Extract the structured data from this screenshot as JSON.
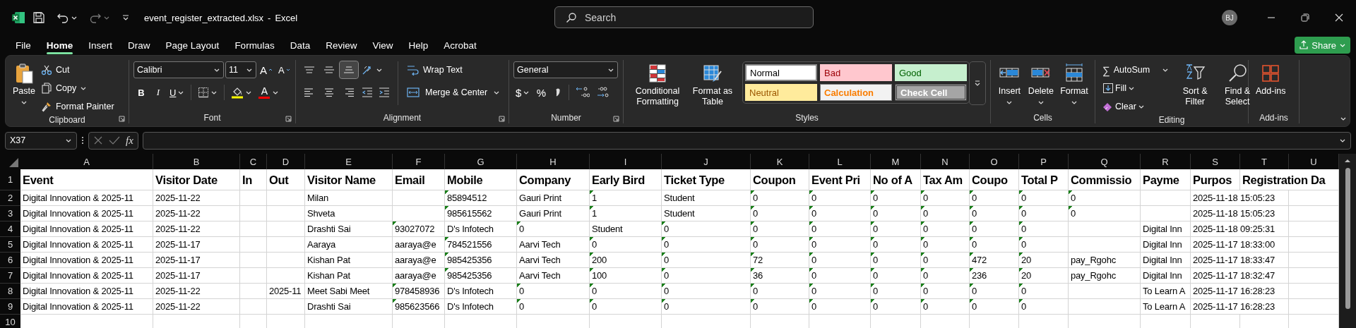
{
  "title_bar": {
    "file_name": "event_register_extracted.xlsx",
    "separator": "-",
    "app_name": "Excel",
    "search": {
      "placeholder": "Search"
    },
    "user_initials": "BJ"
  },
  "menu_tabs": [
    {
      "label": "File",
      "selected": false
    },
    {
      "label": "Home",
      "selected": true
    },
    {
      "label": "Insert",
      "selected": false
    },
    {
      "label": "Draw",
      "selected": false
    },
    {
      "label": "Page Layout",
      "selected": false
    },
    {
      "label": "Formulas",
      "selected": false
    },
    {
      "label": "Data",
      "selected": false
    },
    {
      "label": "Review",
      "selected": false
    },
    {
      "label": "View",
      "selected": false
    },
    {
      "label": "Help",
      "selected": false
    },
    {
      "label": "Acrobat",
      "selected": false
    }
  ],
  "share_button": {
    "label": "Share"
  },
  "ribbon": {
    "groups": [
      {
        "kind": "clipboard",
        "label": "Clipboard",
        "paste": "Paste",
        "cut": "Cut",
        "copy": "Copy",
        "format_painter": "Format Painter"
      },
      {
        "kind": "font",
        "label": "Font",
        "font_name": "Calibri",
        "font_size": "11",
        "grow": "A",
        "shrink": "A",
        "bold": "B",
        "italic": "I",
        "underline": "U",
        "font_color": "A"
      },
      {
        "kind": "alignment",
        "label": "Alignment",
        "vertical_align": [
          {
            "selected": false
          },
          {
            "selected": false
          },
          {
            "selected": true
          }
        ],
        "wrap_text": "Wrap Text",
        "merge_center": "Merge & Center"
      },
      {
        "kind": "number",
        "label": "Number",
        "format": "General",
        "currency": "$",
        "percent": "%"
      },
      {
        "kind": "styles",
        "label": "Styles",
        "conditional_formatting": "Conditional Formatting",
        "format_as_table": "Format as Table",
        "cell_styles": [
          {
            "label": "Normal",
            "kind": "normal"
          },
          {
            "label": "Bad",
            "kind": "bad"
          },
          {
            "label": "Good",
            "kind": "good"
          },
          {
            "label": "Neutral",
            "kind": "neutral"
          },
          {
            "label": "Calculation",
            "kind": "calculation"
          },
          {
            "label": "Check Cell",
            "kind": "check"
          }
        ]
      },
      {
        "kind": "cells",
        "label": "Cells",
        "buttons": [
          "Insert",
          "Delete",
          "Format"
        ]
      },
      {
        "kind": "editing",
        "label": "Editing",
        "autosum_symbol": "∑",
        "autosum": "AutoSum",
        "fill": "Fill",
        "clear": "Clear",
        "sort_filter": "Sort & Filter",
        "find_select": "Find & Select"
      },
      {
        "kind": "addins",
        "label": "Add-ins",
        "button": "Add-ins"
      }
    ]
  },
  "formula_bar": {
    "name_box": "X37",
    "function_label": "fx"
  },
  "sheet": {
    "columns": [
      "A",
      "B",
      "C",
      "D",
      "E",
      "F",
      "G",
      "H",
      "I",
      "J",
      "K",
      "L",
      "M",
      "N",
      "O",
      "P",
      "Q",
      "R",
      "S",
      "T",
      "U"
    ],
    "rows": [
      {
        "number": "1",
        "kind": "header",
        "cells": [
          {
            "text": "Event",
            "warning": false
          },
          {
            "text": "Visitor Date",
            "warning": false
          },
          {
            "text": "In",
            "warning": false
          },
          {
            "text": "Out",
            "warning": false
          },
          {
            "text": "Visitor Name",
            "warning": false
          },
          {
            "text": "Email",
            "warning": false
          },
          {
            "text": "Mobile",
            "warning": false
          },
          {
            "text": "Company",
            "warning": false
          },
          {
            "text": "Early Bird",
            "warning": false
          },
          {
            "text": "Ticket Type",
            "warning": false
          },
          {
            "text": "Coupon",
            "warning": false
          },
          {
            "text": "Event Pri",
            "warning": false
          },
          {
            "text": "No of A",
            "warning": false
          },
          {
            "text": "Tax Am",
            "warning": false
          },
          {
            "text": "Coupo",
            "warning": false
          },
          {
            "text": "Total P",
            "warning": false
          },
          {
            "text": "Commissio",
            "warning": false
          },
          {
            "text": "Payme",
            "warning": false
          },
          {
            "text": "Purpos",
            "warning": false
          },
          {
            "text": "Registration Da",
            "warning": false
          }
        ]
      },
      {
        "number": "2",
        "kind": "data",
        "cells": [
          {
            "text": "Digital Innovation & 2025-11",
            "warning": false
          },
          {
            "text": "2025-11-22",
            "warning": false
          },
          {
            "warning": false
          },
          {
            "warning": false
          },
          {
            "text": "Milan",
            "warning": false
          },
          {
            "warning": false
          },
          {
            "text": "85894512",
            "warning": true
          },
          {
            "text": "Gauri Print",
            "warning": false
          },
          {
            "text": "1",
            "warning": true
          },
          {
            "text": "Student",
            "warning": false
          },
          {
            "text": "0",
            "warning": true
          },
          {
            "text": "0",
            "warning": true
          },
          {
            "text": "0",
            "warning": true
          },
          {
            "text": "0",
            "warning": true
          },
          {
            "text": "0",
            "warning": true
          },
          {
            "text": "0",
            "warning": true
          },
          {
            "text": "0",
            "warning": true
          },
          {
            "warning": false
          },
          {
            "text": "2025-11-18 15:05:23",
            "warning": false
          }
        ]
      },
      {
        "number": "3",
        "kind": "data",
        "cells": [
          {
            "text": "Digital Innovation & 2025-11",
            "warning": false
          },
          {
            "text": "2025-11-22",
            "warning": false
          },
          {
            "warning": false
          },
          {
            "warning": false
          },
          {
            "text": "Shveta",
            "warning": false
          },
          {
            "warning": false
          },
          {
            "text": "985615562",
            "warning": true
          },
          {
            "text": "Gauri Print",
            "warning": false
          },
          {
            "text": "1",
            "warning": true
          },
          {
            "text": "Student",
            "warning": false
          },
          {
            "text": "0",
            "warning": true
          },
          {
            "text": "0",
            "warning": true
          },
          {
            "text": "0",
            "warning": true
          },
          {
            "text": "0",
            "warning": true
          },
          {
            "text": "0",
            "warning": true
          },
          {
            "text": "0",
            "warning": true
          },
          {
            "text": "0",
            "warning": true
          },
          {
            "warning": false
          },
          {
            "text": "2025-11-18 15:05:23",
            "warning": false
          }
        ]
      },
      {
        "number": "4",
        "kind": "data",
        "cells": [
          {
            "text": "Digital Innovation & 2025-11",
            "warning": false
          },
          {
            "text": "2025-11-22",
            "warning": false
          },
          {
            "warning": false
          },
          {
            "warning": false
          },
          {
            "text": "Drashti Sai",
            "warning": false
          },
          {
            "text": "93027072",
            "warning": true
          },
          {
            "text": "D's Infotech",
            "warning": false
          },
          {
            "text": "0",
            "warning": true
          },
          {
            "text": "Student",
            "warning": false
          },
          {
            "text": "0",
            "warning": true
          },
          {
            "text": "0",
            "warning": true
          },
          {
            "text": "0",
            "warning": true
          },
          {
            "text": "0",
            "warning": true
          },
          {
            "text": "0",
            "warning": true
          },
          {
            "text": "0",
            "warning": true
          },
          {
            "text": "0",
            "warning": true
          },
          {
            "warning": false
          },
          {
            "text": "Digital Inn",
            "warning": false
          },
          {
            "text": "2025-11-18 09:25:31",
            "warning": false
          }
        ]
      },
      {
        "number": "5",
        "kind": "data",
        "cells": [
          {
            "text": "Digital Innovation & 2025-11",
            "warning": false
          },
          {
            "text": "2025-11-17",
            "warning": false
          },
          {
            "warning": false
          },
          {
            "warning": false
          },
          {
            "text": "Aaraya",
            "warning": false
          },
          {
            "text": "aaraya@e",
            "warning": false
          },
          {
            "text": "784521556",
            "warning": true
          },
          {
            "text": "Aarvi Tech",
            "warning": false
          },
          {
            "text": "0",
            "warning": true
          },
          {
            "text": "0",
            "warning": true
          },
          {
            "text": "0",
            "warning": true
          },
          {
            "text": "0",
            "warning": true
          },
          {
            "text": "0",
            "warning": true
          },
          {
            "text": "0",
            "warning": true
          },
          {
            "text": "0",
            "warning": true
          },
          {
            "text": "0",
            "warning": true
          },
          {
            "warning": false
          },
          {
            "text": "Digital Inn",
            "warning": false
          },
          {
            "text": "2025-11-17 18:33:00",
            "warning": false
          }
        ]
      },
      {
        "number": "6",
        "kind": "data",
        "cells": [
          {
            "text": "Digital Innovation & 2025-11",
            "warning": false
          },
          {
            "text": "2025-11-17",
            "warning": false
          },
          {
            "warning": false
          },
          {
            "warning": false
          },
          {
            "text": "Kishan Pat",
            "warning": false
          },
          {
            "text": "aaraya@e",
            "warning": false
          },
          {
            "text": "985425356",
            "warning": true
          },
          {
            "text": "Aarvi Tech",
            "warning": false
          },
          {
            "text": "200",
            "warning": true
          },
          {
            "text": "0",
            "warning": true
          },
          {
            "text": "72",
            "warning": true
          },
          {
            "text": "0",
            "warning": true
          },
          {
            "text": "0",
            "warning": true
          },
          {
            "text": "0",
            "warning": true
          },
          {
            "text": "472",
            "warning": true
          },
          {
            "text": "20",
            "warning": true
          },
          {
            "text": "pay_Rgohc",
            "warning": false
          },
          {
            "text": "Digital Inn",
            "warning": false
          },
          {
            "text": "2025-11-17 18:33:47",
            "warning": false
          }
        ]
      },
      {
        "number": "7",
        "kind": "data",
        "cells": [
          {
            "text": "Digital Innovation & 2025-11",
            "warning": false
          },
          {
            "text": "2025-11-17",
            "warning": false
          },
          {
            "warning": false
          },
          {
            "warning": false
          },
          {
            "text": "Kishan Pat",
            "warning": false
          },
          {
            "text": "aaraya@e",
            "warning": false
          },
          {
            "text": "985425356",
            "warning": true
          },
          {
            "text": "Aarvi Tech",
            "warning": false
          },
          {
            "text": "100",
            "warning": true
          },
          {
            "text": "0",
            "warning": true
          },
          {
            "text": "36",
            "warning": true
          },
          {
            "text": "0",
            "warning": true
          },
          {
            "text": "0",
            "warning": true
          },
          {
            "text": "0",
            "warning": true
          },
          {
            "text": "236",
            "warning": true
          },
          {
            "text": "20",
            "warning": true
          },
          {
            "text": "pay_Rgohc",
            "warning": false
          },
          {
            "text": "Digital Inn",
            "warning": false
          },
          {
            "text": "2025-11-17 18:32:47",
            "warning": false
          }
        ]
      },
      {
        "number": "8",
        "kind": "data",
        "cells": [
          {
            "text": "Digital Innovation & 2025-11",
            "warning": false
          },
          {
            "text": "2025-11-22",
            "warning": false
          },
          {
            "warning": false
          },
          {
            "text": "2025-11",
            "warning": false
          },
          {
            "text": "Meet Sabi Meet",
            "warning": false
          },
          {
            "text": "978458936",
            "warning": true
          },
          {
            "text": "D's Infotech",
            "warning": false
          },
          {
            "text": "0",
            "warning": true
          },
          {
            "text": "0",
            "warning": true
          },
          {
            "text": "0",
            "warning": true
          },
          {
            "text": "0",
            "warning": true
          },
          {
            "text": "0",
            "warning": true
          },
          {
            "text": "0",
            "warning": true
          },
          {
            "text": "0",
            "warning": true
          },
          {
            "text": "0",
            "warning": true
          },
          {
            "text": "0",
            "warning": true
          },
          {
            "warning": false
          },
          {
            "text": "To Learn A",
            "warning": false
          },
          {
            "text": "2025-11-17 16:28:23",
            "warning": false
          }
        ]
      },
      {
        "number": "9",
        "kind": "data",
        "cells": [
          {
            "text": "Digital Innovation & 2025-11",
            "warning": false
          },
          {
            "text": "2025-11-22",
            "warning": false
          },
          {
            "warning": false
          },
          {
            "warning": false
          },
          {
            "text": "Drashti Sai",
            "warning": false
          },
          {
            "text": "985623566",
            "warning": true
          },
          {
            "text": "D's Infotech",
            "warning": false
          },
          {
            "text": "0",
            "warning": true
          },
          {
            "text": "0",
            "warning": true
          },
          {
            "text": "0",
            "warning": true
          },
          {
            "text": "0",
            "warning": true
          },
          {
            "text": "0",
            "warning": true
          },
          {
            "text": "0",
            "warning": true
          },
          {
            "text": "0",
            "warning": true
          },
          {
            "text": "0",
            "warning": true
          },
          {
            "text": "0",
            "warning": true
          },
          {
            "warning": false
          },
          {
            "text": "To Learn A",
            "warning": false
          },
          {
            "text": "2025-11-17 16:28:23",
            "warning": false
          }
        ]
      },
      {
        "number": "10",
        "kind": "data"
      }
    ]
  }
}
